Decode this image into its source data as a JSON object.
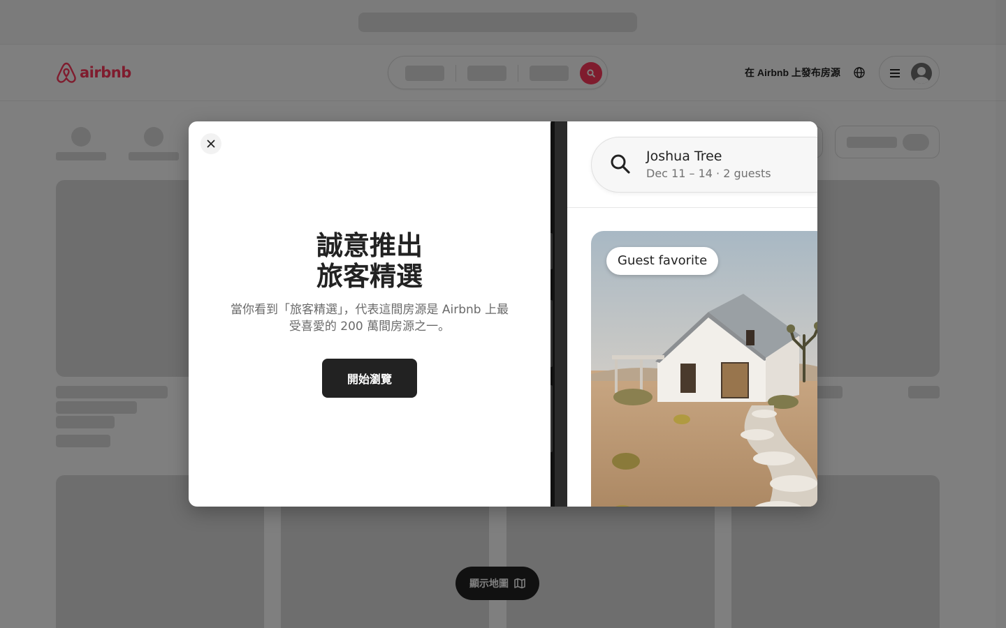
{
  "brand": {
    "name": "airbnb",
    "color": "#ff385c"
  },
  "header": {
    "host_link": "在 Airbnb 上發布房源",
    "globe_icon": "globe-icon",
    "menu_icon": "hamburger-menu-icon",
    "avatar_icon": "user-avatar-icon"
  },
  "map_button": {
    "label": "顯示地圖",
    "icon": "map-icon"
  },
  "modal": {
    "title_line1": "誠意推出",
    "title_line2": "旅客精選",
    "description": "當你看到「旅客精選」，代表這間房源是 Airbnb 上最受喜愛的 200 萬間房源之一。",
    "button_label": "開始瀏覽",
    "close_icon": "close-icon",
    "preview": {
      "search_title": "Joshua Tree",
      "search_subtitle": "Dec 11 – 14 · 2 guests",
      "badge": "Guest favorite"
    }
  }
}
